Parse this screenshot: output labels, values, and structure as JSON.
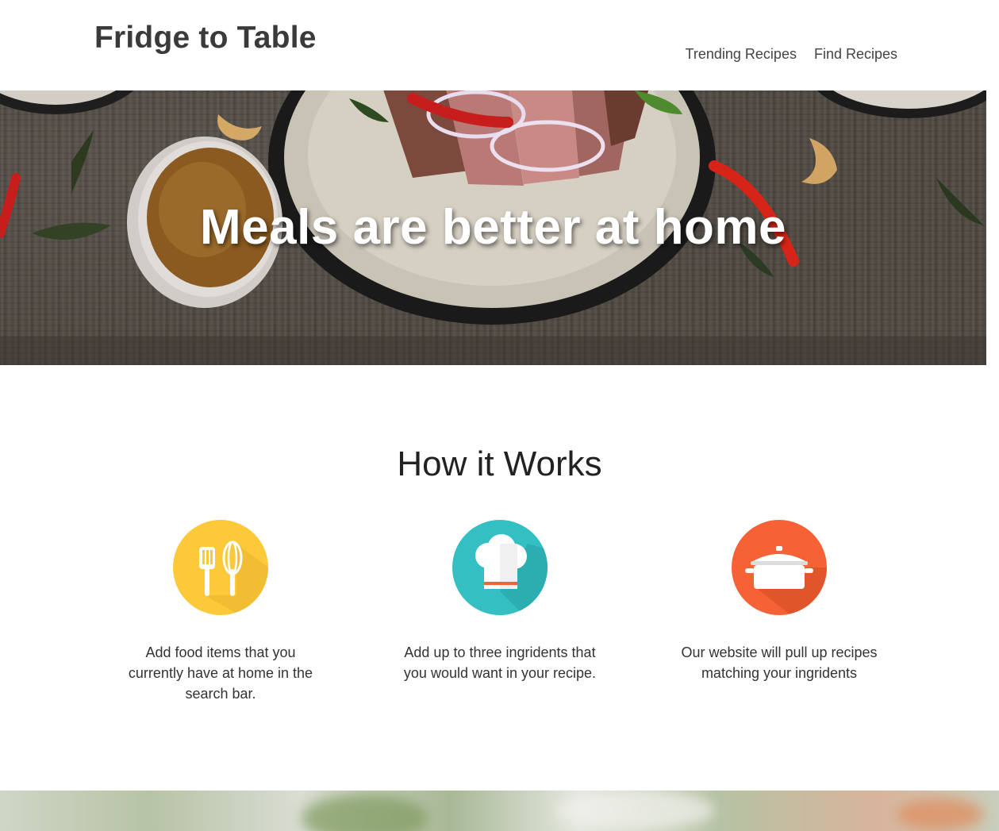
{
  "header": {
    "brand": "Fridge to Table",
    "nav": [
      {
        "label": "Trending Recipes"
      },
      {
        "label": "Find Recipes"
      }
    ]
  },
  "hero": {
    "title": "Meals are better at home"
  },
  "how_it_works": {
    "title": "How it Works",
    "steps": [
      {
        "icon": "utensils-icon",
        "color": "#FCC93B",
        "text": "Add food items that you currently have at home in the search bar."
      },
      {
        "icon": "chef-hat-icon",
        "color": "#34BFC3",
        "text": "Add up to three ingridents that you would want in your recipe."
      },
      {
        "icon": "cooking-pot-icon",
        "color": "#F56236",
        "text": "Our website will pull up recipes matching your ingridents"
      }
    ]
  }
}
